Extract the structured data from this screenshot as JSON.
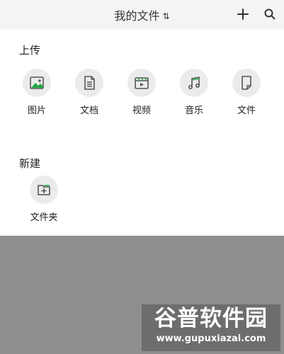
{
  "header": {
    "title": "我的文件",
    "sort_icon": "sort-icon",
    "add_icon": "plus-icon",
    "search_icon": "search-icon"
  },
  "upload": {
    "title": "上传",
    "items": [
      {
        "label": "图片",
        "icon": "image-icon"
      },
      {
        "label": "文档",
        "icon": "document-icon"
      },
      {
        "label": "视频",
        "icon": "video-icon"
      },
      {
        "label": "音乐",
        "icon": "music-icon"
      },
      {
        "label": "文件",
        "icon": "file-icon"
      }
    ]
  },
  "create": {
    "title": "新建",
    "items": [
      {
        "label": "文件夹",
        "icon": "folder-add-icon"
      }
    ]
  },
  "watermark": {
    "text": "谷普软件园",
    "url": "www.gupuxiazai.com"
  },
  "colors": {
    "accent_green": "#22a845",
    "icon_gray": "#555555",
    "overlay": "#8e8e8e"
  }
}
